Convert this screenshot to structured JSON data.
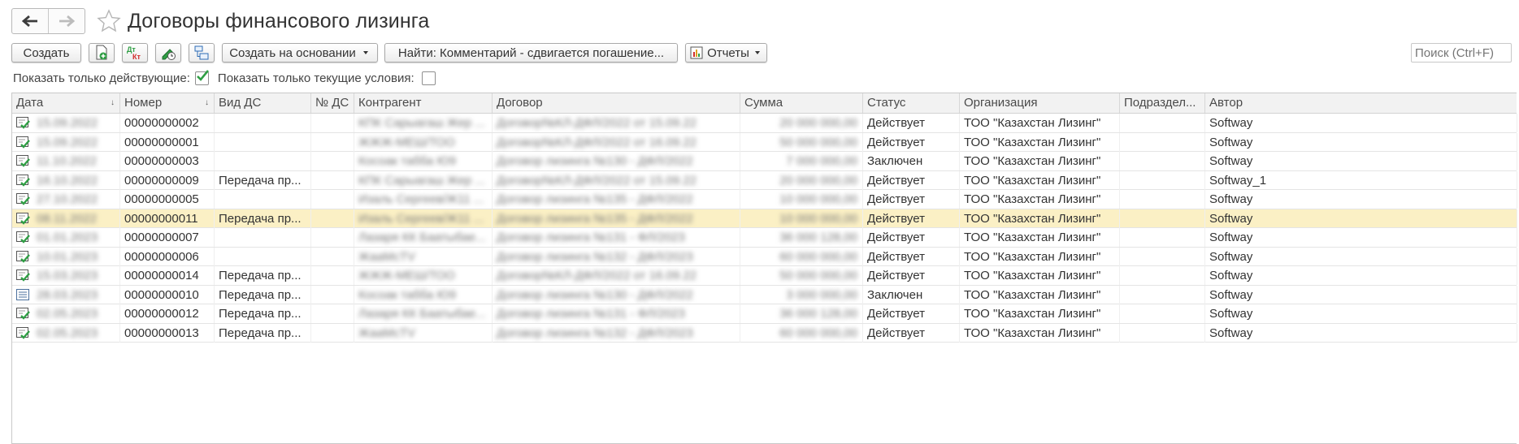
{
  "window": {
    "title": "Договоры финансового лизинга"
  },
  "toolbar": {
    "create_label": "Создать",
    "create_based_label": "Создать на основании",
    "find_label": "Найти: Комментарий - сдвигается погашение...",
    "reports_label": "Отчеты",
    "icons": [
      "add-doc-icon",
      "dt-kt-icon",
      "edit-clock-icon",
      "structure-icon"
    ],
    "search_placeholder": "Поиск (Ctrl+F)"
  },
  "filters": {
    "active_only_label": "Показать только действующие:",
    "active_only_checked": true,
    "current_terms_label": "Показать только текущие условия:",
    "current_terms_checked": false
  },
  "table": {
    "columns": [
      "Дата",
      "Номер",
      "Вид ДС",
      "№ ДС",
      "Контрагент",
      "Договор",
      "Сумма",
      "Статус",
      "Организация",
      "Подраздел...",
      "Автор"
    ],
    "rows": [
      {
        "date": "15.09.2022",
        "number": "00000000002",
        "kind": "",
        "ds_no": "",
        "counterparty": "КПК Сарыагаш Жер ...",
        "contract": "Договор№КЛ-ДФЛ/2022 от 15.09.22",
        "sum": "20 000 000,00",
        "status": "Действует",
        "org": "ТОО \"Казахстан Лизинг\"",
        "dept": "",
        "author": "Softway",
        "icon": "doc-check-icon"
      },
      {
        "date": "15.09.2022",
        "number": "00000000001",
        "kind": "",
        "ds_no": "",
        "counterparty": "ЖЖЖ-МЕШ/ТОО",
        "contract": "Договор№КЛ-ДФЛ/2022 от 16.09.22",
        "sum": "50 000 000,00",
        "status": "Действует",
        "org": "ТОО \"Казахстан Лизинг\"",
        "dept": "",
        "author": "Softway",
        "icon": "doc-check-icon"
      },
      {
        "date": "11.10.2022",
        "number": "00000000003",
        "kind": "",
        "ds_no": "",
        "counterparty": "Косоак табба Ю9",
        "contract": "Договор лизинга №130 - ДФЛ/2022",
        "sum": "7 000 000,00",
        "status": "Заключен",
        "org": "ТОО \"Казахстан Лизинг\"",
        "dept": "",
        "author": "Softway",
        "icon": "doc-check-icon"
      },
      {
        "date": "16.10.2022",
        "number": "00000000009",
        "kind": "Передача пр...",
        "ds_no": "",
        "counterparty": "КПК Сарыагаш Жер ...",
        "contract": "Договор№КЛ-ДФЛ/2022 от 15.09.22",
        "sum": "20 000 000,00",
        "status": "Действует",
        "org": "ТОО \"Казахстан Лизинг\"",
        "dept": "",
        "author": "Softway_1",
        "icon": "doc-check-icon"
      },
      {
        "date": "27.10.2022",
        "number": "00000000005",
        "kind": "",
        "ds_no": "",
        "counterparty": "Изаль Сергеев/Ж11 ...",
        "contract": "Договор лизинга №135 - ДФЛ/2022",
        "sum": "10 000 000,00",
        "status": "Действует",
        "org": "ТОО \"Казахстан Лизинг\"",
        "dept": "",
        "author": "Softway",
        "icon": "doc-check-icon"
      },
      {
        "date": "08.11.2022",
        "number": "00000000011",
        "kind": "Передача пр...",
        "ds_no": "",
        "counterparty": "Изаль Сергеев/Ж11 ...",
        "contract": "Договор лизинга №135 - ДФЛ/2022",
        "sum": "10 000 000,00",
        "status": "Действует",
        "org": "ТОО \"Казахстан Лизинг\"",
        "dept": "",
        "author": "Softway",
        "icon": "doc-check-icon"
      },
      {
        "date": "01.01.2023",
        "number": "00000000007",
        "kind": "",
        "ds_no": "",
        "counterparty": "Лазаря КК Баатыбае...",
        "contract": "Договор лизинга №131 - ФЛ/2023",
        "sum": "36 000 128,00",
        "status": "Действует",
        "org": "ТОО \"Казахстан Лизинг\"",
        "dept": "",
        "author": "Softway",
        "icon": "doc-check-icon"
      },
      {
        "date": "10.01.2023",
        "number": "00000000006",
        "kind": "",
        "ds_no": "",
        "counterparty": "ЖааМсТV",
        "contract": "Договор лизинга №132 - ДФЛ/2023",
        "sum": "60 000 000,00",
        "status": "Действует",
        "org": "ТОО \"Казахстан Лизинг\"",
        "dept": "",
        "author": "Softway",
        "icon": "doc-check-icon"
      },
      {
        "date": "15.03.2023",
        "number": "00000000014",
        "kind": "Передача пр...",
        "ds_no": "",
        "counterparty": "ЖЖЖ-МЕШ/ТОО",
        "contract": "Договор№КЛ-ДФЛ/2022 от 16.09.22",
        "sum": "50 000 000,00",
        "status": "Действует",
        "org": "ТОО \"Казахстан Лизинг\"",
        "dept": "",
        "author": "Softway",
        "icon": "doc-check-icon"
      },
      {
        "date": "28.03.2023",
        "number": "00000000010",
        "kind": "Передача пр...",
        "ds_no": "",
        "counterparty": "Косоак табба Ю9",
        "contract": "Договор лизинга №130 - ДФЛ/2022",
        "sum": "3 000 000,00",
        "status": "Заключен",
        "org": "ТОО \"Казахстан Лизинг\"",
        "dept": "",
        "author": "Softway",
        "icon": "doc-list-icon"
      },
      {
        "date": "02.05.2023",
        "number": "00000000012",
        "kind": "Передача пр...",
        "ds_no": "",
        "counterparty": "Лазаря КК Баатыбае...",
        "contract": "Договор лизинга №131 - ФЛ/2023",
        "sum": "36 000 128,00",
        "status": "Действует",
        "org": "ТОО \"Казахстан Лизинг\"",
        "dept": "",
        "author": "Softway",
        "icon": "doc-check-icon"
      },
      {
        "date": "02.05.2023",
        "number": "00000000013",
        "kind": "Передача пр...",
        "ds_no": "",
        "counterparty": "ЖааМсТV",
        "contract": "Договор лизинга №132 - ДФЛ/2023",
        "sum": "60 000 000,00",
        "status": "Действует",
        "org": "ТОО \"Казахстан Лизинг\"",
        "dept": "",
        "author": "Softway",
        "icon": "doc-check-icon"
      }
    ]
  },
  "colors": {
    "selected_row": "#fbf0c5",
    "check_green": "#2f9e44",
    "header_bg": "#f2f2f2"
  }
}
